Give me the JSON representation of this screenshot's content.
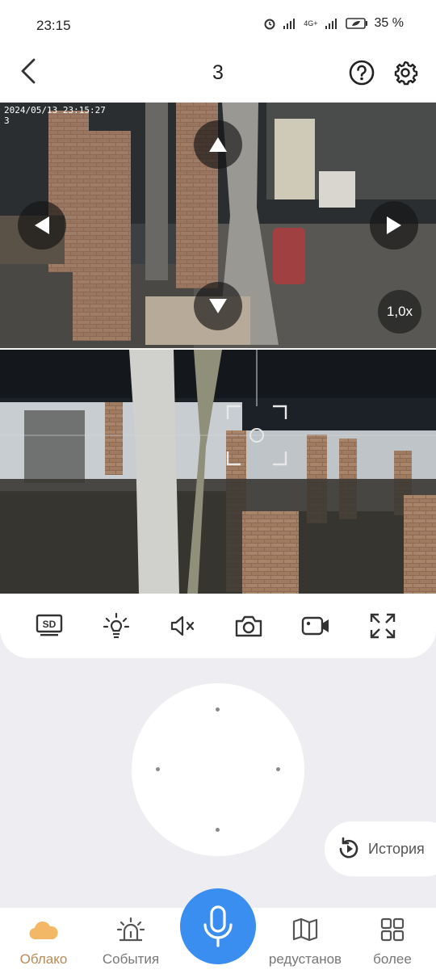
{
  "status_bar": {
    "time": "23:15",
    "network": "4G+",
    "battery": "35 %"
  },
  "header": {
    "title": "3"
  },
  "camera": {
    "timestamp": "2024/05/13 23:15:27",
    "channel": "3",
    "zoom": "1,0x"
  },
  "toolbar": {
    "icons": [
      "sd-card-icon",
      "light-icon",
      "mute-icon",
      "snapshot-icon",
      "record-icon",
      "fullscreen-icon"
    ]
  },
  "history": {
    "label": "История"
  },
  "nav": {
    "items": [
      {
        "label": "Облако",
        "icon": "cloud-icon",
        "active": true
      },
      {
        "label": "События",
        "icon": "alarm-icon",
        "active": false
      },
      {
        "label": "редустанов",
        "icon": "map-icon",
        "active": false
      },
      {
        "label": "более",
        "icon": "grid-icon",
        "active": false
      }
    ]
  },
  "colors": {
    "accent": "#3a8ef0",
    "active_tab": "#b98a55"
  }
}
